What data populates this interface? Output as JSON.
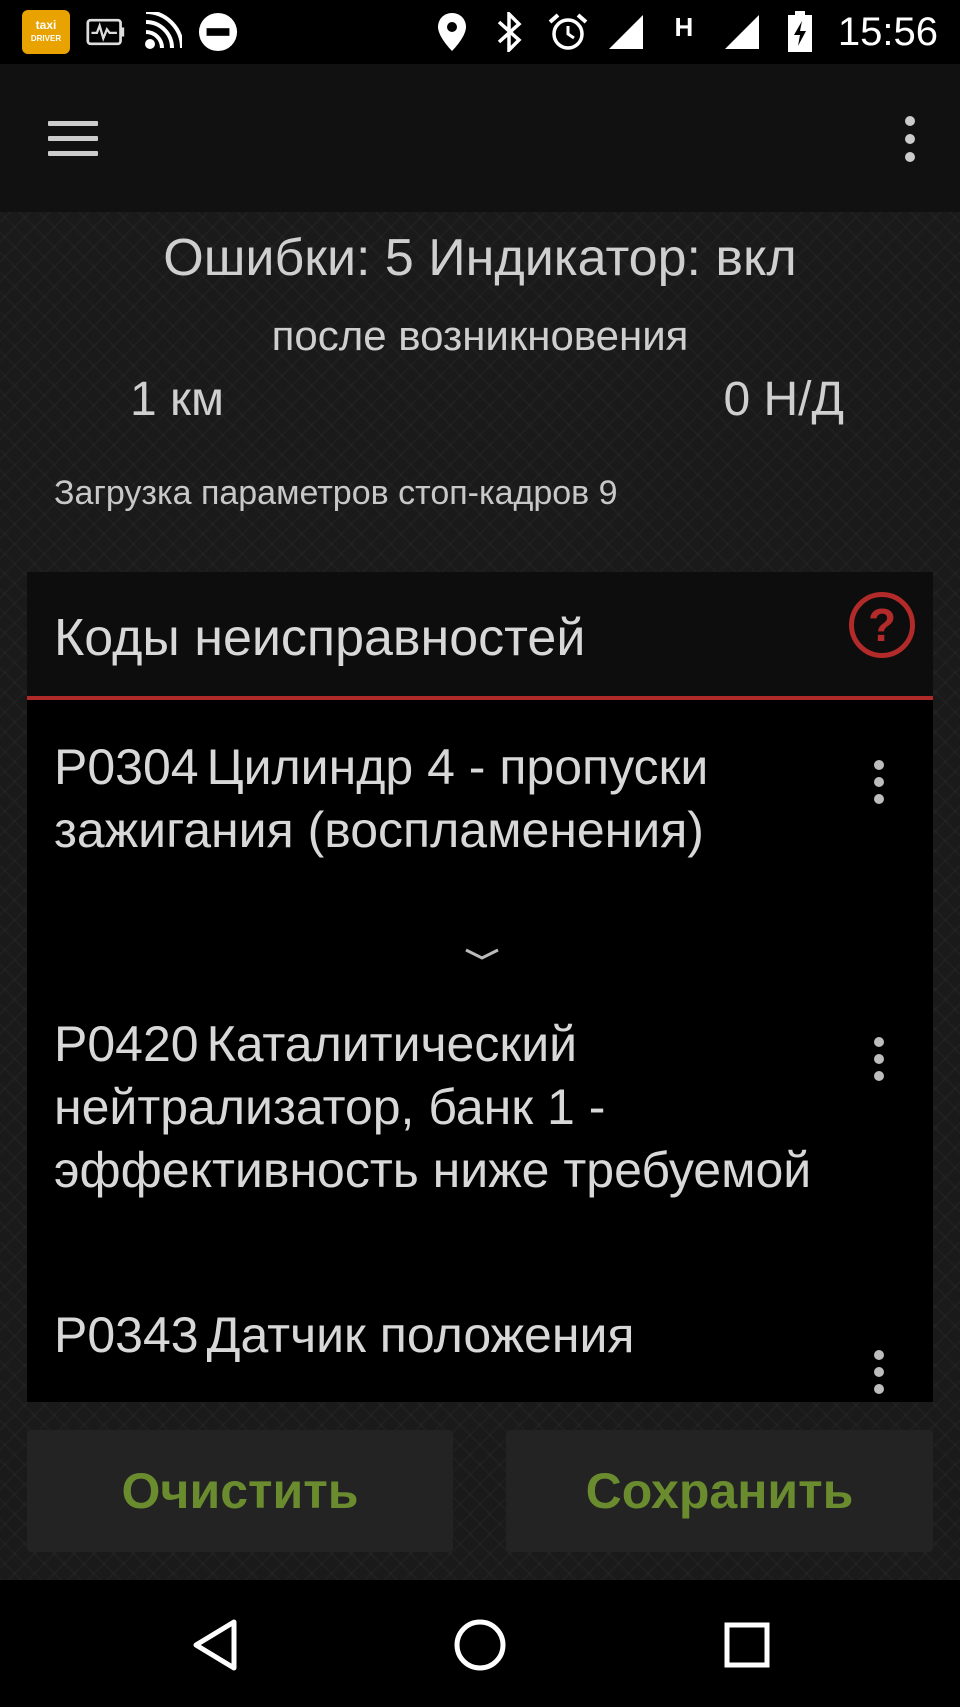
{
  "status_bar": {
    "time": "15:56",
    "app_icon_line1": "taxi",
    "app_icon_line2": "DRIVER",
    "icons": [
      "taxi-driver-app-icon",
      "obd-monitor-icon",
      "wifi-signal-icon",
      "do-not-disturb-icon",
      "location-icon",
      "bluetooth-icon",
      "alarm-icon",
      "cell-signal-icon",
      "network-h-icon",
      "cell-signal-icon",
      "battery-charging-icon"
    ],
    "network_type": "H"
  },
  "toolbar": {
    "menu_icon": "hamburger-menu-icon",
    "overflow_icon": "more-vert-icon"
  },
  "summary": {
    "errors_line": "Ошибки: 5 Индикатор: вкл",
    "after_label": "после возникновения",
    "distance": "1 км",
    "time_value": "0 Н/Д",
    "loading_text": "Загрузка параметров стоп-кадров 9"
  },
  "codes_card": {
    "title": "Коды неисправностей",
    "help_icon": "help-icon",
    "help_glyph": "?",
    "accent_color": "#b02a2a",
    "items": [
      {
        "code": "P0304",
        "description": "Цилиндр 4 - пропуски зажигания (воспламенения)"
      },
      {
        "code": "P0420",
        "description": "Каталитический нейтрализатор, банк 1 - эффективность ниже требуемой"
      },
      {
        "code": "P0343",
        "description": "Датчик положения"
      }
    ]
  },
  "buttons": {
    "clear_label": "Очистить",
    "save_label": "Сохранить",
    "label_color": "#6a8c2e"
  },
  "nav_bar": {
    "icons": [
      "back-icon",
      "home-icon",
      "recents-icon"
    ]
  }
}
